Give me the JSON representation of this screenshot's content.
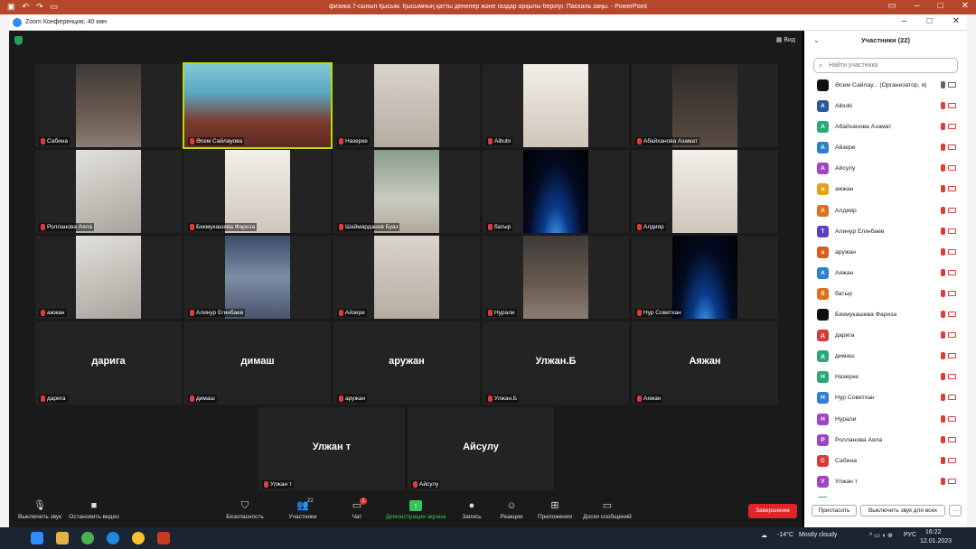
{
  "ppt": {
    "title": "физика 7-сынып Қысым. Қысымның қатты денелер және газдар арқылы берілуі. Паскаль заңы. - PowerPoint"
  },
  "zoom": {
    "window_title": "Zoom Конференция, 40 кмн",
    "view_label": "Вид",
    "tiles": [
      {
        "name": "Сабина",
        "look": "v-room",
        "active": false
      },
      {
        "name": "Әсем Сайлауова",
        "look": "v-tank",
        "active": true
      },
      {
        "name": "Назерке",
        "look": "v-light",
        "active": false
      },
      {
        "name": "Aibubi",
        "look": "v-bright",
        "active": false
      },
      {
        "name": "Абайханова Азамат",
        "look": "v-dark",
        "active": false
      },
      {
        "name": "Ролланова Аяла",
        "look": "v-wall",
        "active": false
      },
      {
        "name": "Бекмукашева Фариза",
        "look": "v-bright",
        "active": false
      },
      {
        "name": "Шаймарданов Буаз",
        "look": "v-green",
        "active": false
      },
      {
        "name": "батыр",
        "look": "v-space",
        "active": false
      },
      {
        "name": "Алдияр",
        "look": "v-bright",
        "active": false
      },
      {
        "name": "ажжан",
        "look": "v-wall",
        "active": false
      },
      {
        "name": "Алинур Егинбаев",
        "look": "v-cloud",
        "active": false
      },
      {
        "name": "Айзере",
        "look": "v-light",
        "active": false
      },
      {
        "name": "Нурали",
        "look": "v-room",
        "active": false
      },
      {
        "name": "Нур Советхан",
        "look": "v-space",
        "active": false
      },
      {
        "name": "дарига",
        "center": "дарига"
      },
      {
        "name": "димаш",
        "center": "димаш"
      },
      {
        "name": "аружан",
        "center": "аружан"
      },
      {
        "name": "Улжан.Б",
        "center": "Улжан.Б"
      },
      {
        "name": "Аяжан",
        "center": "Аяжан"
      },
      {
        "name": "Улжан т",
        "center": "Улжан т"
      },
      {
        "name": "Айсулу",
        "center": "Айсулу"
      }
    ],
    "toolbar": {
      "mute": "Выключить звук",
      "video": "Остановить видео",
      "security": "Безопасность",
      "participants": "Участники",
      "participants_count": "22",
      "chat": "Чат",
      "chat_badge": "1",
      "share": "Демонстрация экрана",
      "record": "Запись",
      "reactions": "Реакции",
      "apps": "Приложения",
      "whiteboard": "Доски сообщений",
      "end": "Завершение"
    }
  },
  "panel": {
    "title": "Участники (22)",
    "search_placeholder": "Найти участника",
    "participants": [
      {
        "initial": "",
        "color": "#111111",
        "name": "Әсем Сайлау... (Организатор, я)",
        "mic_ok": true,
        "cam_ok": true
      },
      {
        "initial": "A",
        "color": "#2a5a9a",
        "name": "Aibubi",
        "mic_ok": false,
        "cam_ok": false
      },
      {
        "initial": "А",
        "color": "#2aa876",
        "name": "Абайханова Азамат",
        "mic_ok": false,
        "cam_ok": false
      },
      {
        "initial": "А",
        "color": "#2f7fd0",
        "name": "Айзере",
        "mic_ok": false,
        "cam_ok": false
      },
      {
        "initial": "А",
        "color": "#a045c8",
        "name": "Айсулу",
        "mic_ok": false,
        "cam_ok": false
      },
      {
        "initial": "а",
        "color": "#e3a21a",
        "name": "ажжан",
        "mic_ok": false,
        "cam_ok": false
      },
      {
        "initial": "А",
        "color": "#e07020",
        "name": "Алдияр",
        "mic_ok": false,
        "cam_ok": false
      },
      {
        "initial": "Т",
        "color": "#5a3fc0",
        "name": "Алинур Егинбаев",
        "mic_ok": false,
        "cam_ok": false
      },
      {
        "initial": "а",
        "color": "#e05a20",
        "name": "аружан",
        "mic_ok": false,
        "cam_ok": false
      },
      {
        "initial": "А",
        "color": "#2f7fd0",
        "name": "Аяжан",
        "mic_ok": false,
        "cam_ok": false
      },
      {
        "initial": "б",
        "color": "#e07020",
        "name": "батыр",
        "mic_ok": false,
        "cam_ok": false
      },
      {
        "initial": "",
        "color": "#111111",
        "name": "Бекмукашева Фариза",
        "mic_ok": false,
        "cam_ok": false
      },
      {
        "initial": "д",
        "color": "#d83a3a",
        "name": "дарига",
        "mic_ok": false,
        "cam_ok": false
      },
      {
        "initial": "д",
        "color": "#2aa876",
        "name": "димаш",
        "mic_ok": false,
        "cam_ok": false
      },
      {
        "initial": "Н",
        "color": "#2aa876",
        "name": "Назерке",
        "mic_ok": false,
        "cam_ok": false
      },
      {
        "initial": "Н",
        "color": "#2f7fd0",
        "name": "Нур Советхан",
        "mic_ok": false,
        "cam_ok": false
      },
      {
        "initial": "Н",
        "color": "#a045c8",
        "name": "Нурали",
        "mic_ok": false,
        "cam_ok": false
      },
      {
        "initial": "Р",
        "color": "#a045c8",
        "name": "Ролланова Аяла",
        "mic_ok": false,
        "cam_ok": false
      },
      {
        "initial": "С",
        "color": "#d83a3a",
        "name": "Сабина",
        "mic_ok": false,
        "cam_ok": false
      },
      {
        "initial": "У",
        "color": "#a045c8",
        "name": "Улжан т",
        "mic_ok": false,
        "cam_ok": false
      },
      {
        "initial": "",
        "color": "#2aa876",
        "name": "",
        "mic_ok": false,
        "cam_ok": false
      }
    ],
    "invite": "Пригласить",
    "unmute_all": "Выключить звук для всех",
    "more": "···"
  },
  "taskbar": {
    "weather": "-14°C",
    "weather_desc": "Mostly cloudy",
    "lang": "РУС",
    "time": "16:22",
    "date": "12.01.2023"
  }
}
